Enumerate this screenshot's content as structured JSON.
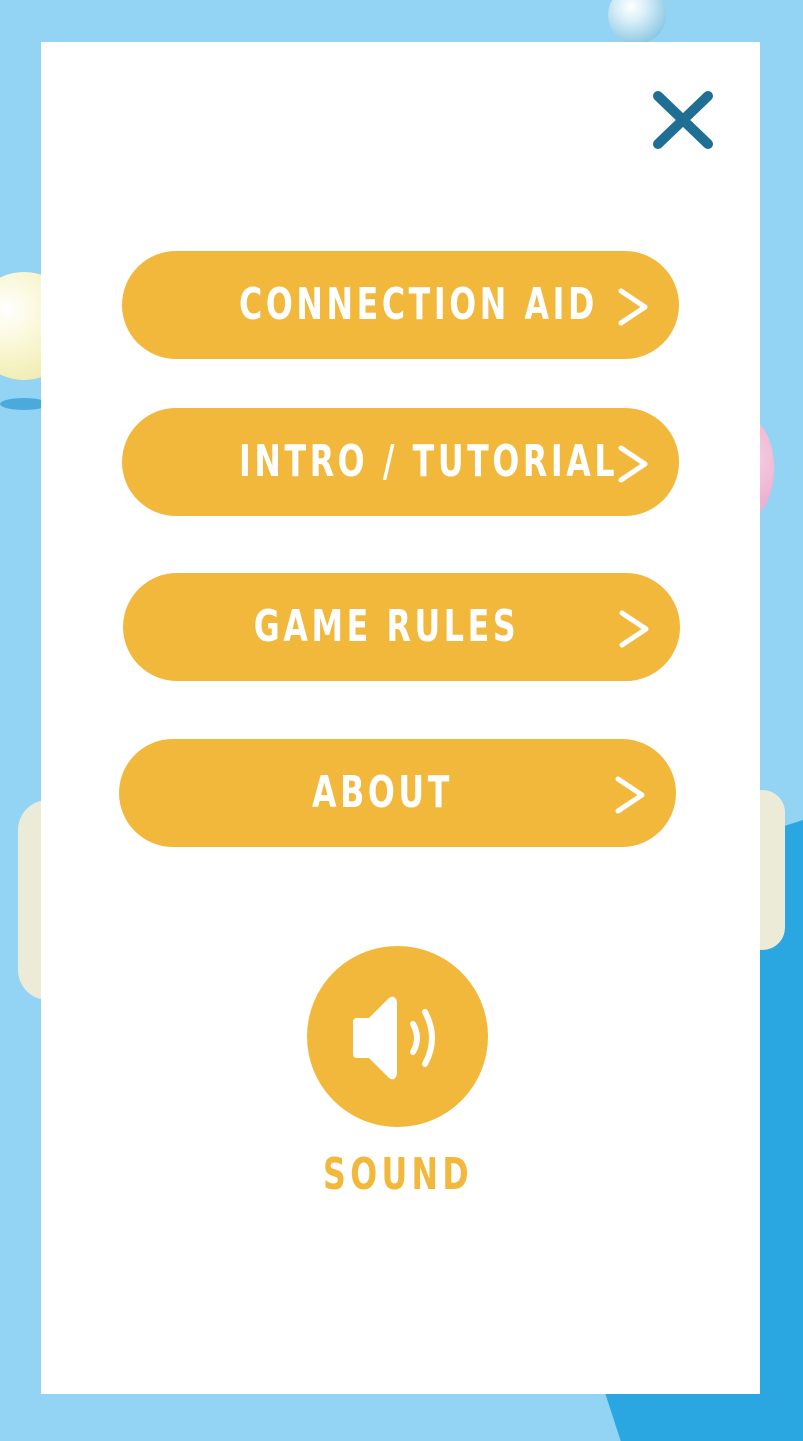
{
  "menu": {
    "close_icon": "close-icon",
    "items": [
      {
        "label": "CONNECTION AID",
        "icon": "chevron-right-icon"
      },
      {
        "label": "INTRO  / TUTORIAL",
        "icon": "chevron-right-icon"
      },
      {
        "label": "GAME RULES",
        "icon": "chevron-right-icon"
      },
      {
        "label": "ABOUT",
        "icon": "chevron-right-icon"
      }
    ],
    "sound": {
      "label": "SOUND",
      "icon": "speaker-icon"
    }
  },
  "colors": {
    "background": "#93d3f4",
    "accent": "#f1b83c",
    "close": "#1e6f93",
    "panel": "#ffffff"
  }
}
